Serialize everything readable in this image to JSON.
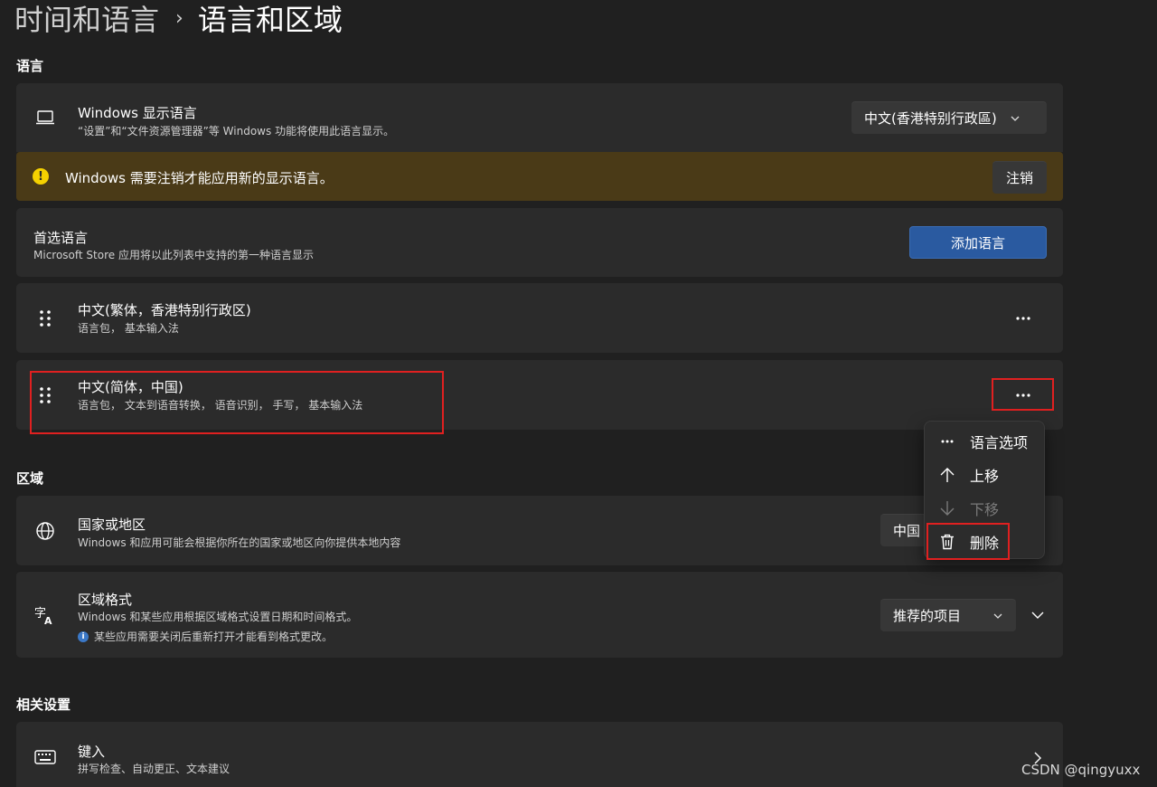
{
  "breadcrumb": {
    "parent": "时间和语言",
    "separator": "›",
    "current": "语言和区域"
  },
  "sections": {
    "language": "语言",
    "region": "区域",
    "related": "相关设置"
  },
  "display_language": {
    "icon": "laptop-icon",
    "title": "Windows 显示语言",
    "subtitle": "“设置”和“文件资源管理器”等 Windows 功能将使用此语言显示。",
    "selected": "中文(香港特别行政區)"
  },
  "warning": {
    "icon": "warning-icon",
    "text": "Windows 需要注销才能应用新的显示语言。",
    "button": "注销"
  },
  "preferred": {
    "title": "首选语言",
    "subtitle": "Microsoft Store 应用将以此列表中支持的第一种语言显示",
    "add_button": "添加语言"
  },
  "languages": [
    {
      "title": "中文(繁体，香港特别行政区)",
      "subtitle": "语言包， 基本输入法",
      "more": "···"
    },
    {
      "title": "中文(简体，中国)",
      "subtitle": "语言包， 文本到语音转换， 语音识别， 手写， 基本输入法",
      "more": "···"
    }
  ],
  "context_menu": [
    {
      "icon": "more-icon",
      "label": "语言选项",
      "enabled": true
    },
    {
      "icon": "arrow-up-icon",
      "label": "上移",
      "enabled": true
    },
    {
      "icon": "arrow-down-icon",
      "label": "下移",
      "enabled": false
    },
    {
      "icon": "trash-icon",
      "label": "删除",
      "enabled": true
    }
  ],
  "country": {
    "icon": "globe-icon",
    "title": "国家或地区",
    "subtitle": "Windows 和应用可能会根据你所在的国家或地区向你提供本地内容",
    "selected": "中国"
  },
  "regional_format": {
    "icon": "language-format-icon",
    "title": "区域格式",
    "subtitle": "Windows 和某些应用根据区域格式设置日期和时间格式。",
    "note": "某些应用需要关闭后重新打开才能看到格式更改。",
    "selected": "推荐的项目"
  },
  "typing": {
    "icon": "keyboard-icon",
    "title": "键入",
    "subtitle": "拼写检查、自动更正、文本建议"
  },
  "watermark": "CSDN @qingyuxx",
  "colors": {
    "background": "#202020",
    "card": "#2b2b2b",
    "accent": "#2a5aa0",
    "warning_bar": "#4a3a17",
    "highlight": "#e02020"
  }
}
